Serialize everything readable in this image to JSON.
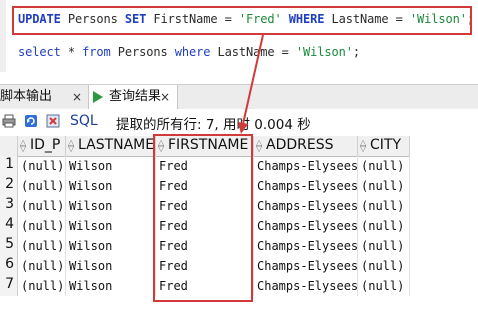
{
  "editor": {
    "line1": {
      "t1": "UPDATE",
      "t2": " Persons ",
      "t3": "SET",
      "t4": " FirstName = ",
      "t5": "'Fred'",
      "t6": " ",
      "t7": "WHERE",
      "t8": " LastName = ",
      "t9": "'Wilson'",
      "t10": ";"
    },
    "line2": {
      "t1": "select",
      "t2": " * ",
      "t3": "from",
      "t4": " Persons ",
      "t5": "where",
      "t6": " LastName = ",
      "t7": "'Wilson'",
      "t8": ";"
    }
  },
  "tabs": {
    "output_label": "脚本输出",
    "output_close": "×",
    "result_label": "查询结果",
    "result_close": "×"
  },
  "toolbar": {
    "sql_label": "SQL",
    "status": "提取的所有行: 7, 用时 0.004 秒"
  },
  "table": {
    "columns": [
      "ID_P",
      "LASTNAME",
      "FIRSTNAME",
      "ADDRESS",
      "CITY"
    ],
    "rows": [
      {
        "num": "1",
        "id": "(null)",
        "last": "Wilson",
        "first": "Fred",
        "addr": "Champs-Elysees",
        "city": "(null)"
      },
      {
        "num": "2",
        "id": "(null)",
        "last": "Wilson",
        "first": "Fred",
        "addr": "Champs-Elysees",
        "city": "(null)"
      },
      {
        "num": "3",
        "id": "(null)",
        "last": "Wilson",
        "first": "Fred",
        "addr": "Champs-Elysees",
        "city": "(null)"
      },
      {
        "num": "4",
        "id": "(null)",
        "last": "Wilson",
        "first": "Fred",
        "addr": "Champs-Elysees",
        "city": "(null)"
      },
      {
        "num": "5",
        "id": "(null)",
        "last": "Wilson",
        "first": "Fred",
        "addr": "Champs-Elysees",
        "city": "(null)"
      },
      {
        "num": "6",
        "id": "(null)",
        "last": "Wilson",
        "first": "Fred",
        "addr": "Champs-Elysees",
        "city": "(null)"
      },
      {
        "num": "7",
        "id": "(null)",
        "last": "Wilson",
        "first": "Fred",
        "addr": "Champs-Elysees",
        "city": "(null)"
      }
    ]
  },
  "colors": {
    "highlight": "#d23a3a",
    "keyword": "#1f3fbf",
    "string": "#1a8a3a"
  }
}
